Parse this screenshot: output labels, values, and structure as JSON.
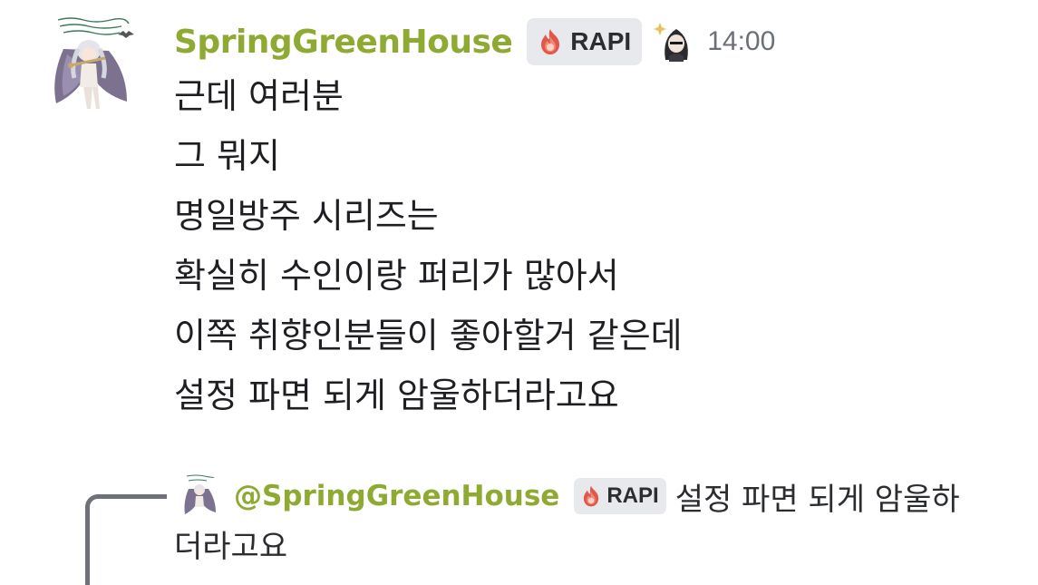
{
  "message": {
    "author": "SpringGreenHouse",
    "tag": "RAPI",
    "timestamp": "14:00",
    "lines": [
      "근데 여러분",
      "그 뭐지",
      "명일방주 시리즈는",
      "확실히 수인이랑 퍼리가 많아서",
      "이쪽 취향인분들이 좋아할거 같은데",
      "설정 파면 되게 암울하더라고요"
    ],
    "avatar_icon": "anime-character-avatar-icon",
    "tag_icon": "fire-icon",
    "role_icon": "dark-haired-character-role-icon"
  },
  "reply": {
    "mention": "@SpringGreenHouse",
    "tag": "RAPI",
    "text_line1": "설정 파면 되게 암울하",
    "text_line2": "더라고요"
  },
  "colors": {
    "username": "#8faa32",
    "tag_bg": "#e8e9ec",
    "timestamp": "#6b6f76",
    "reply_spine": "#6e7178"
  }
}
